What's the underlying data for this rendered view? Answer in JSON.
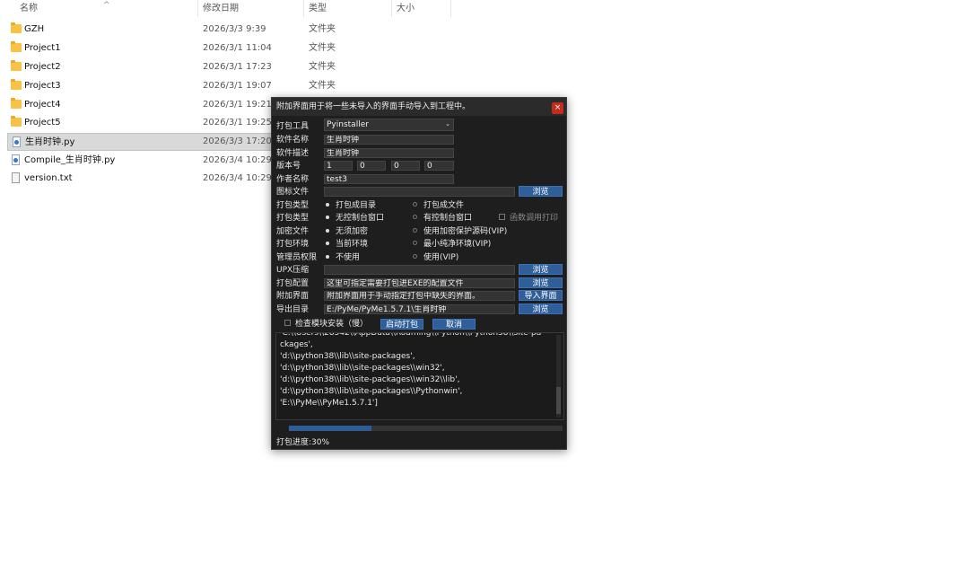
{
  "explorer": {
    "columns": {
      "name": "名称",
      "date": "修改日期",
      "type": "类型",
      "size": "大小"
    },
    "files": [
      {
        "name": "GZH",
        "date": "2026/3/3 9:39",
        "type": "文件夹",
        "icon": "folder-icon"
      },
      {
        "name": "Project1",
        "date": "2026/3/1 11:04",
        "type": "文件夹",
        "icon": "folder-icon"
      },
      {
        "name": "Project2",
        "date": "2026/3/1 17:23",
        "type": "文件夹",
        "icon": "folder-icon"
      },
      {
        "name": "Project3",
        "date": "2026/3/1 19:07",
        "type": "文件夹",
        "icon": "folder-icon"
      },
      {
        "name": "Project4",
        "date": "2026/3/1 19:21",
        "type": "文件夹",
        "icon": "folder-icon"
      },
      {
        "name": "Project5",
        "date": "2026/3/1 19:25",
        "type": "文件夹",
        "icon": "folder-icon"
      },
      {
        "name": "生肖时钟.py",
        "date": "2026/3/3 17:20",
        "type": "",
        "icon": "python-file-icon"
      },
      {
        "name": "Compile_生肖时钟.py",
        "date": "2026/3/4 10:29",
        "type": "",
        "icon": "python-file-icon"
      },
      {
        "name": "version.txt",
        "date": "2026/3/4 10:29",
        "type": "",
        "icon": "text-file-icon"
      }
    ]
  },
  "dialog": {
    "title": "附加界面用于将一些未导入的界面手动导入到工程中。",
    "close_label": "×",
    "labels": {
      "tool": "打包工具",
      "software_name": "软件名称",
      "software_desc": "软件描述",
      "version": "版本号",
      "author": "作者名称",
      "icon_file": "图标文件",
      "pack_type": "打包类型",
      "window_type": "打包类型",
      "encrypt": "加密文件",
      "env": "打包环境",
      "admin": "管理员权限",
      "upx": "UPX压缩",
      "config": "打包配置",
      "extra_ui": "附加界面",
      "output_dir": "导出目录"
    },
    "values": {
      "tool": "Pyinstaller",
      "software_name": "生肖时钟",
      "software_desc": "生肖时钟",
      "version": [
        "1",
        "0",
        "0",
        "0"
      ],
      "author": "test3",
      "icon_file": "",
      "upx": "",
      "config": "这里可指定需要打包进EXE的配置文件",
      "extra_ui": "附加界面用于手动指定打包中缺失的界面。",
      "output_dir": "E:/PyMe/PyMe1.5.7.1\\生肖时钟"
    },
    "options": {
      "pack_dir": "打包成目录",
      "pack_file": "打包成文件",
      "no_console": "无控制台窗口",
      "console": "有控制台窗口",
      "func_print": "函数调用打印",
      "no_encrypt": "无须加密",
      "encrypt_vip": "使用加密保护源码(VIP)",
      "current_env": "当前环境",
      "min_env": "最小纯净环境(VIP)",
      "no_admin": "不使用",
      "admin_vip": "使用(VIP)",
      "check_modules": "检查模块安装（慢）"
    },
    "buttons": {
      "browse": "浏览",
      "import_ui": "导入界面",
      "start": "启动打包",
      "cancel": "取消"
    },
    "log_lines": [
      "'C:\\\\Users\\\\28542\\\\AppData\\\\Roaming\\\\Python\\\\Python38\\\\site-pa",
      "ckages',",
      "'d:\\\\python38\\\\lib\\\\site-packages',",
      "'d:\\\\python38\\\\lib\\\\site-packages\\\\win32',",
      "'d:\\\\python38\\\\lib\\\\site-packages\\\\win32\\\\lib',",
      "'d:\\\\python38\\\\lib\\\\site-packages\\\\Pythonwin',",
      "'E:\\\\PyMe\\\\PyMe1.5.7.1']"
    ],
    "progress": 0.3,
    "status": "打包进度:30%",
    "colors": {
      "accent": "#2f5f9a",
      "close": "#c42b1c",
      "background": "#1e1e1e"
    }
  }
}
